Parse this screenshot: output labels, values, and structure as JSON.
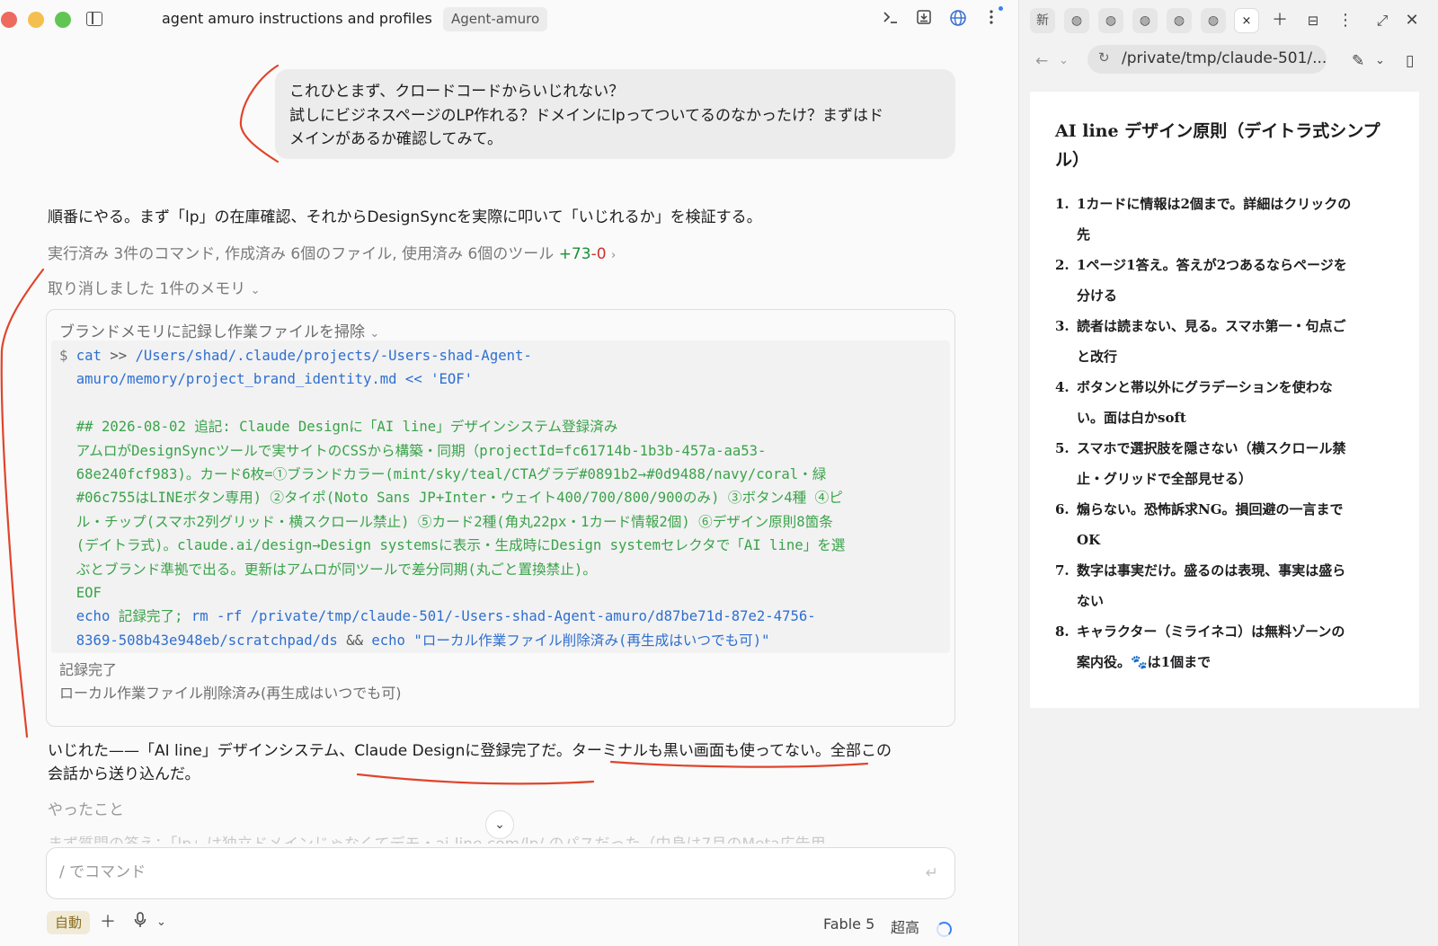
{
  "window": {
    "title": "agent amuro instructions and profiles",
    "project_chip": "Agent-amuro"
  },
  "toolbar": {
    "terminal_icon": "terminal-icon",
    "share_icon": "share-icon",
    "globe_icon": "globe-icon",
    "more_icon": "more-vertical-icon"
  },
  "conversation": {
    "user_message": {
      "line1": "これひとまず、クロードコードからいじれない？",
      "line2": "試しにビジネスページのLP作れる？ドメインにlpってついてるのなかったけ？まずはド",
      "line3": "メインがあるか確認してみて。"
    },
    "assistant_intro": "順番にやる。まず「lp」の在庫確認、それからDesignSyncを実際に叩いて「いじれるか」を検証する。",
    "summary": {
      "text": "実行済み 3件のコマンド, 作成済み 6個のファイル, 使用済み 6個のツール",
      "added": "+73",
      "removed": "-0"
    },
    "memory_toggle": "取り消しました 1件のメモリ",
    "tool_call": {
      "title": "ブランドメモリに記録し作業ファイルを掃除",
      "prompt": "$",
      "code": {
        "l1_cmd": "cat",
        "l1_op": " >> ",
        "l1_path": "/Users/shad/.claude/projects/-Users-shad-Agent-",
        "l2_path": "amuro/memory/project_brand_identity.md",
        "l2_rest": " << 'EOF'",
        "l4": "## 2026-08-02 追記: Claude Designに「AI line」デザインシステム登録済み",
        "l5": "アムロがDesignSyncツールで実サイトのCSSから構築・同期（projectId=fc61714b-1b3b-457a-aa53-",
        "l6": "68e240fcf983)。カード6枚=①ブランドカラー(mint/sky/teal/CTAグラデ#0891b2→#0d9488/navy/coral・緑",
        "l7": "#06c755はLINEボタン専用) ②タイポ(Noto Sans JP+Inter・ウェイト400/700/800/900のみ) ③ボタン4種 ④ピ",
        "l8": "ル・チップ(スマホ2列グリッド・横スクロール禁止) ⑤カード2種(角丸22px・1カード情報2個) ⑥デザイン原則8箇条",
        "l9": "(デイトラ式)。claude.ai/design→Design systemsに表示・生成時にDesign systemセレクタで「AI line」を選",
        "l10": "ぶとブランド準拠で出る。更新はアムロが同ツールで差分同期(丸ごと置換禁止)。",
        "l11": "EOF",
        "l12_echo": "echo",
        "l12_mid": " 記録完了; ",
        "l12_rm": "rm -rf /private/tmp/claude-501/-Users-shad-Agent-amuro/d87be71d-87e2-4756-",
        "l13_path": "8369-508b43e948eb/scratchpad/ds",
        "l13_and": " && ",
        "l13_echo": "echo",
        "l13_str": " \"ローカル作業ファイル削除済み(再生成はいつでも可)\""
      },
      "output_line1": "記録完了",
      "output_line2": "ローカル作業ファイル削除済み(再生成はいつでも可)"
    },
    "assistant_result_line1": "いじれた——「AI line」デザインシステム、Claude Designに登録完了だ。ターミナルも黒い画面も使ってない。全部この",
    "assistant_result_line2": "会話から送り込んだ。",
    "section_heading": "やったこと",
    "faded_line": "まず質問の答え：「lp」は独立ドメインじゃなくてデモ・ai-line.com/lp/ のパスだった（中身は7月のMeta広告用"
  },
  "composer": {
    "placeholder": "/ でコマンド",
    "send_icon": "return-icon"
  },
  "bottom_bar": {
    "mode": "自動",
    "add_icon": "plus-icon",
    "mic_icon": "microphone-icon",
    "model": "Fable 5",
    "effort": "超高"
  },
  "browser": {
    "tab_new": "新",
    "tab_close": "×",
    "address": "/private/tmp/claude-501/...",
    "doc": {
      "title": "AI line デザイン原則（デイトラ式シンプル）",
      "items": [
        {
          "num": "1.",
          "line1": "1カードに情報は2個まで。詳細はクリックの",
          "line2": "先"
        },
        {
          "num": "2.",
          "line1": "1ページ1答え。答えが2つあるならページを",
          "line2": "分ける"
        },
        {
          "num": "3.",
          "line1": "読者は読まない、見る。スマホ第一・句点ご",
          "line2": "と改行"
        },
        {
          "num": "4.",
          "line1": "ボタンと帯以外にグラデーションを使わな",
          "line2": "い。面は白かsoft"
        },
        {
          "num": "5.",
          "line1": "スマホで選択肢を隠さない（横スクロール禁",
          "line2": "止・グリッドで全部見せる）"
        },
        {
          "num": "6.",
          "line1": "煽らない。恐怖訴求NG。損回避の一言まで",
          "line2": "OK"
        },
        {
          "num": "7.",
          "line1": "数字は事実だけ。盛るのは表現、事実は盛ら",
          "line2": "ない"
        },
        {
          "num": "8.",
          "line1": "キャラクター（ミライネコ）は無料ゾーンの",
          "line2": "案内役。🐾は1個まで"
        }
      ]
    }
  },
  "colors": {
    "accent_blue": "#3b82f6",
    "diff_added": "#1a8f35",
    "diff_removed": "#d0312d",
    "annotation_red": "#e0452b"
  }
}
